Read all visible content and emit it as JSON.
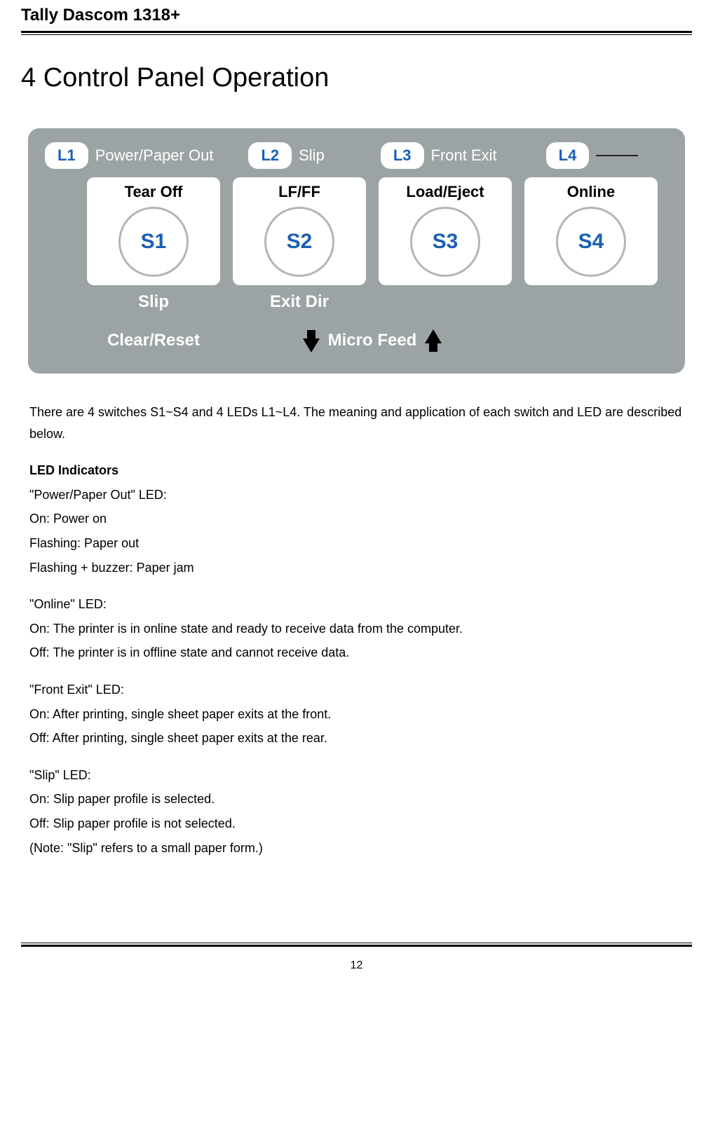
{
  "header": {
    "title": "Tally Dascom 1318+"
  },
  "section": {
    "title": "4 Control Panel Operation"
  },
  "panel": {
    "leds": [
      {
        "id": "L1",
        "label": "Power/Paper Out"
      },
      {
        "id": "L2",
        "label": "Slip"
      },
      {
        "id": "L3",
        "label": "Front Exit"
      },
      {
        "id": "L4",
        "label": ""
      }
    ],
    "buttons": [
      {
        "id": "S1",
        "top": "Tear Off",
        "sub": "Slip"
      },
      {
        "id": "S2",
        "top": "LF/FF",
        "sub": "Exit Dir"
      },
      {
        "id": "S3",
        "top": "Load/Eject",
        "sub": ""
      },
      {
        "id": "S4",
        "top": "Online",
        "sub": ""
      }
    ],
    "micro": {
      "left": "Clear/Reset",
      "center": "Micro Feed"
    }
  },
  "body": {
    "intro": "There are 4 switches S1~S4 and 4 LEDs L1~L4. The meaning and application of each switch and LED are described below.",
    "led_heading": "LED Indicators",
    "power": {
      "title": "\"Power/Paper Out\" LED:",
      "l1": "On: Power on",
      "l2": "Flashing: Paper out",
      "l3": "Flashing + buzzer: Paper jam"
    },
    "online": {
      "title": "\"Online\" LED:",
      "l1": "On: The printer is in online state and ready to receive data from the computer.",
      "l2": "Off: The printer is in offline state and cannot receive data."
    },
    "front": {
      "title": "\"Front Exit\" LED:",
      "l1": "On: After printing, single sheet paper exits at the front.",
      "l2": "Off: After printing, single sheet paper exits at the rear."
    },
    "slip": {
      "title": "\"Slip\" LED:",
      "l1": "On: Slip paper profile is selected.",
      "l2": "Off: Slip paper profile is not selected.",
      "l3": "(Note: \"Slip\" refers to a small paper form.)"
    }
  },
  "page_number": "12"
}
